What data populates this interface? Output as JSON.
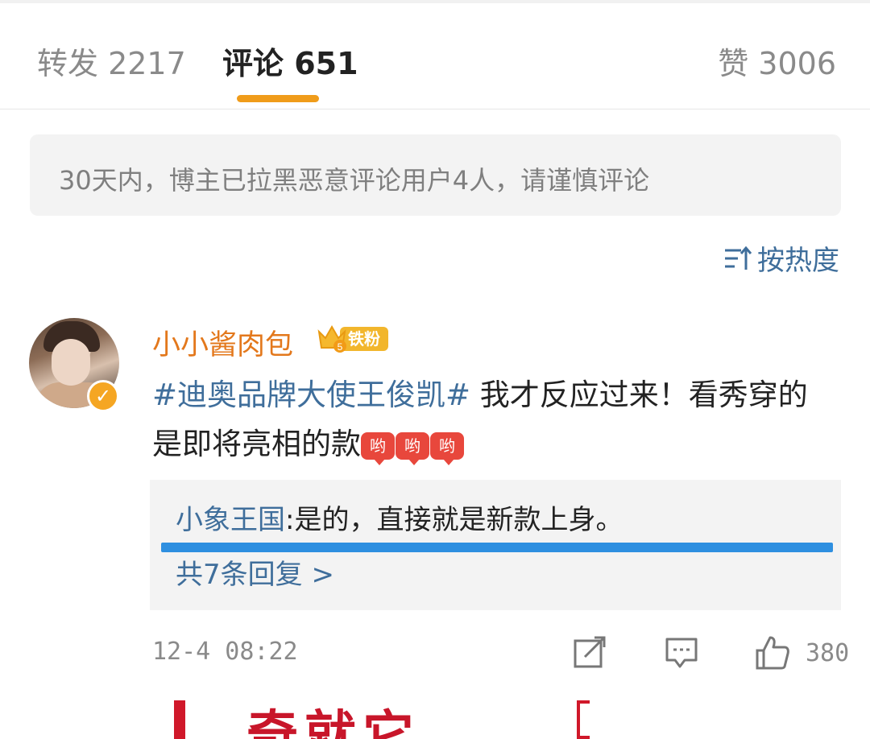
{
  "tabs": {
    "repost": "转发 2217",
    "comments": "评论 651",
    "likes": "赞 3006"
  },
  "notice": "30天内，博主已拉黑恶意评论用户4人，请谨慎评论",
  "sort": {
    "label": "按热度",
    "icon": "sort-icon"
  },
  "comment": {
    "username": "小小酱肉包",
    "badge": "铁粉",
    "topic": "#迪奥品牌大使王俊凯#",
    "text": " 我才反应过来！看秀穿的是即将亮相的款",
    "emoji_label": "哟",
    "reply": {
      "user": "小象王国",
      "text": ":是的，直接就是新款上身。",
      "count_label": "共7条回复 >"
    },
    "time": "12-4 08:22",
    "like_count": "380"
  },
  "colors": {
    "accent_orange": "#f09c1a",
    "link_blue": "#3f6e9b",
    "username_orange": "#e3781c",
    "underline_blue": "#2e8fe0"
  },
  "bottom_image_text": "奇就它"
}
